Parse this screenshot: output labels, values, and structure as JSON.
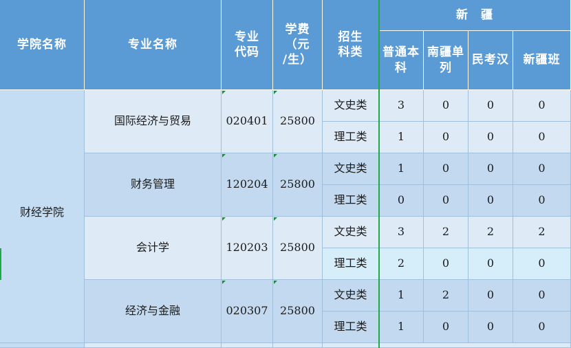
{
  "header": {
    "college": "学院名称",
    "major": "专业名称",
    "code": "专业\n代码",
    "fee": "学费\n（元\n/生）",
    "category": "招生\n科类",
    "region": "新　疆",
    "sub": [
      "普通本\n科",
      "南疆单\n列",
      "民考汉",
      "新疆班"
    ]
  },
  "college_name": "财经学院",
  "majors": [
    {
      "name": "国际经济与贸易",
      "code": "020401",
      "fee": "25800",
      "rows": [
        {
          "cat": "文史类",
          "v": [
            "3",
            "0",
            "0",
            "0"
          ]
        },
        {
          "cat": "理工类",
          "v": [
            "1",
            "0",
            "0",
            "0"
          ]
        }
      ]
    },
    {
      "name": "财务管理",
      "code": "120204",
      "fee": "25800",
      "rows": [
        {
          "cat": "文史类",
          "v": [
            "1",
            "0",
            "0",
            "0"
          ]
        },
        {
          "cat": "理工类",
          "v": [
            "0",
            "0",
            "0",
            "0"
          ]
        }
      ]
    },
    {
      "name": "会计学",
      "code": "120203",
      "fee": "25800",
      "rows": [
        {
          "cat": "文史类",
          "v": [
            "3",
            "2",
            "2",
            "2"
          ]
        },
        {
          "cat": "理工类",
          "v": [
            "2",
            "0",
            "0",
            "0"
          ]
        }
      ]
    },
    {
      "name": "经济与金融",
      "code": "020307",
      "fee": "25800",
      "rows": [
        {
          "cat": "文史类",
          "v": [
            "1",
            "2",
            "0",
            "0"
          ]
        },
        {
          "cat": "理工类",
          "v": [
            "1",
            "0",
            "0",
            "0"
          ]
        }
      ]
    }
  ]
}
